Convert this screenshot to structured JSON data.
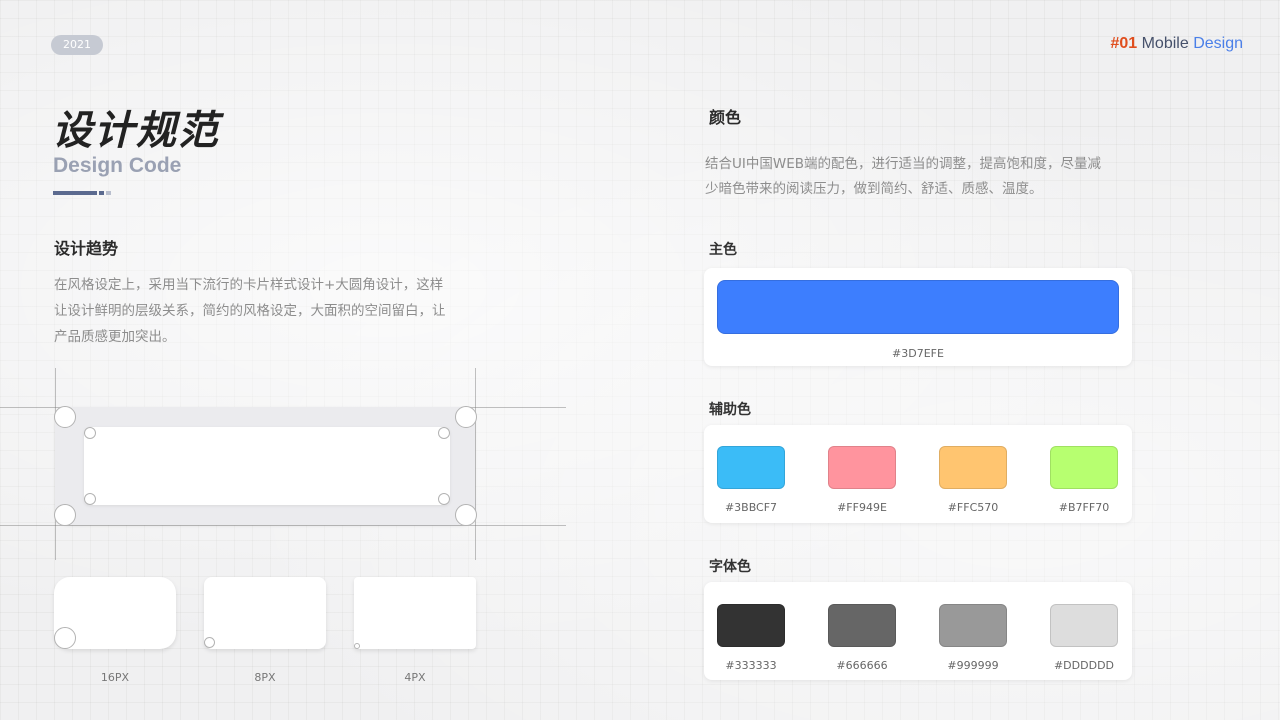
{
  "header": {
    "year": "2021",
    "brand_num": "#01",
    "brand_word1": "Mobile",
    "brand_word2": "Design"
  },
  "title": {
    "zh": "设计规范",
    "en": "Design Code"
  },
  "trend": {
    "heading": "设计趋势",
    "lines": [
      "在风格设定上，采用当下流行的卡片样式设计+大圆角设计，这样",
      "让设计鲜明的层级关系，简约的风格设定，大面积的空间留白，让",
      "产品质感更加突出。"
    ],
    "radius_labels": [
      "16PX",
      "8PX",
      "4PX"
    ]
  },
  "color": {
    "heading": "颜色",
    "lines": [
      "结合UI中国WEB端的配色，进行适当的调整，提高饱和度，尽量减",
      "少暗色带来的阅读压力，做到简约、舒适、质感、温度。"
    ],
    "primary": {
      "label": "主色",
      "swatch": {
        "color": "#3D7EFE",
        "hex": "#3D7EFE"
      }
    },
    "secondary": {
      "label": "辅助色",
      "swatches": [
        {
          "color": "#3BBCF7",
          "hex": "#3BBCF7"
        },
        {
          "color": "#FF949E",
          "hex": "#FF949E"
        },
        {
          "color": "#FFC570",
          "hex": "#FFC570"
        },
        {
          "color": "#B7FF70",
          "hex": "#B7FF70"
        }
      ]
    },
    "font": {
      "label": "字体色",
      "swatches": [
        {
          "color": "#333333",
          "hex": "#333333"
        },
        {
          "color": "#666666",
          "hex": "#666666"
        },
        {
          "color": "#999999",
          "hex": "#999999"
        },
        {
          "color": "#DDDDDD",
          "hex": "#DDDDDD"
        }
      ]
    }
  }
}
